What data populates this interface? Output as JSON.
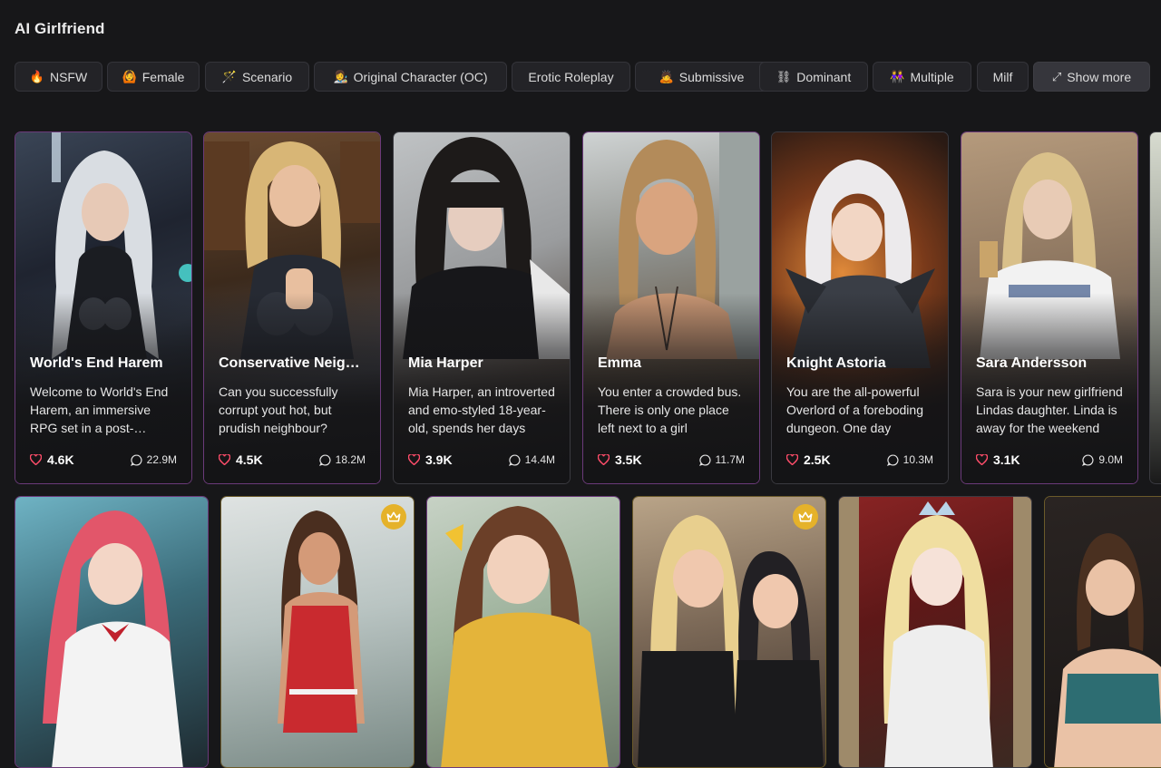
{
  "page": {
    "title": "AI Girlfriend"
  },
  "tags": [
    {
      "label": "NSFW",
      "icon": "🔥"
    },
    {
      "label": "Female",
      "icon": "🙆"
    },
    {
      "label": "Scenario",
      "icon": "🪄"
    },
    {
      "label": "Original Character (OC)",
      "icon": "👩‍🎨"
    },
    {
      "label": "Erotic Roleplay",
      "icon": ""
    },
    {
      "label": "Submissive",
      "icon": "🙇"
    },
    {
      "label": "Dominant",
      "icon": "⛓"
    },
    {
      "label": "Multiple",
      "icon": "👭"
    },
    {
      "label": "Milf",
      "icon": ""
    },
    {
      "label": "Show more",
      "icon": "⤢"
    }
  ],
  "row1": [
    {
      "name": "World's End Harem",
      "desc": "Welcome to World's End Harem, an immersive RPG set in a post-apocalyptic world",
      "likes": "4.6K",
      "messages": "22.9M"
    },
    {
      "name": "Conservative Neighbour",
      "desc": "Can you successfully corrupt yout hot, but prudish neighbour?",
      "likes": "4.5K",
      "messages": "18.2M"
    },
    {
      "name": "Mia Harper",
      "desc": "Mia Harper, an introverted and emo-styled 18-year-old, spends her days",
      "likes": "3.9K",
      "messages": "14.4M"
    },
    {
      "name": "Emma",
      "desc": "You enter a crowded bus. There is only one place left next to a girl",
      "likes": "3.5K",
      "messages": "11.7M"
    },
    {
      "name": "Knight Astoria",
      "desc": "You are the all-powerful Overlord of a foreboding dungeon. One day",
      "likes": "2.5K",
      "messages": "10.3M"
    },
    {
      "name": "Sara Andersson",
      "desc": "Sara is your new girlfriend Lindas daughter. Linda is away for the weekend",
      "likes": "3.1K",
      "messages": "9.0M"
    }
  ],
  "icons": {
    "like": "heart-icon",
    "message": "chat-bubble-icon",
    "premium": "crown-icon",
    "expand": "expand-icon"
  },
  "colors": {
    "background": "#171719",
    "like": "#ff4d6a",
    "premium": "#e5b22a"
  }
}
